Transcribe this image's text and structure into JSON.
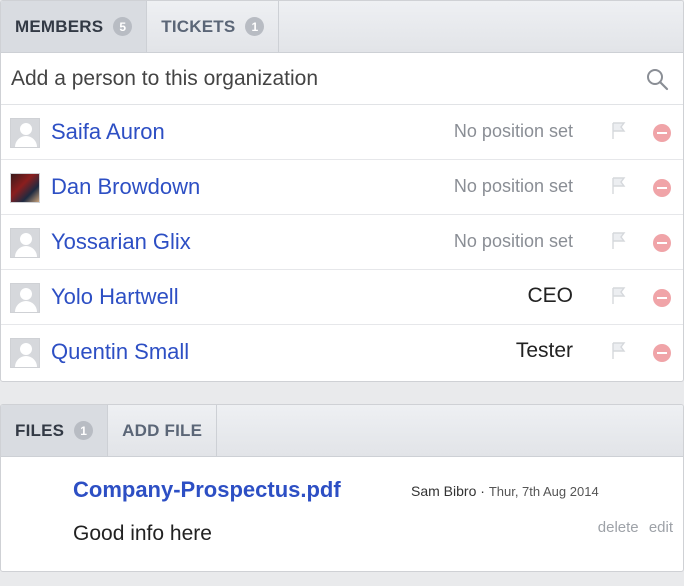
{
  "members_panel": {
    "tabs": [
      {
        "label": "MEMBERS",
        "count": "5"
      },
      {
        "label": "TICKETS",
        "count": "1"
      }
    ],
    "search_placeholder": "Add a person to this organization",
    "members": [
      {
        "name": "Saifa Auron",
        "position": "No position set"
      },
      {
        "name": "Dan Browdown",
        "position": "No position set"
      },
      {
        "name": "Yossarian Glix",
        "position": "No position set"
      },
      {
        "name": "Yolo Hartwell",
        "position": "CEO"
      },
      {
        "name": "Quentin Small",
        "position": "Tester"
      }
    ]
  },
  "files_panel": {
    "tabs": [
      {
        "label": "FILES",
        "count": "1"
      },
      {
        "label": "ADD FILE"
      }
    ],
    "file": {
      "name": "Company-Prospectus.pdf",
      "uploader": "Sam Bibro",
      "separator": "·",
      "date": "Thur, 7th Aug 2014",
      "description": "Good info here",
      "delete_label": "delete",
      "edit_label": "edit"
    }
  },
  "colors": {
    "link": "#2d4fc4",
    "remove": "#f0a4a8",
    "badge": "#b8bcc3"
  }
}
